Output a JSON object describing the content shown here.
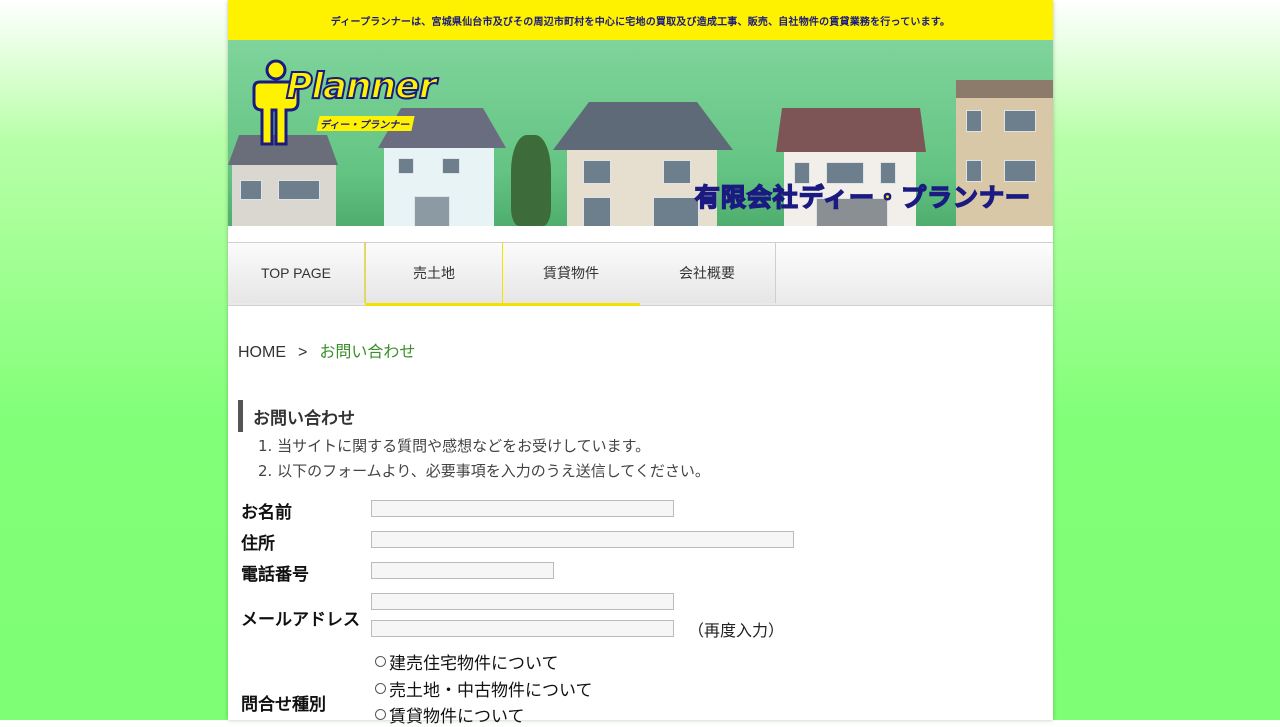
{
  "topbar": {
    "notice": "ディープランナーは、宮城県仙台市及びその周辺市町村を中心に宅地の買取及び造成工事、販売、自社物件の賃貸業務を行っています。"
  },
  "header": {
    "logo_text": "Planner",
    "logo_sub": "ディー・プランナー",
    "company_name": "有限会社ディー・プランナー"
  },
  "nav": {
    "items": [
      {
        "label": "TOP PAGE"
      },
      {
        "label": "売土地"
      },
      {
        "label": "賃貸物件"
      },
      {
        "label": "会社概要"
      }
    ]
  },
  "breadcrumb": {
    "home": "HOME",
    "separator": ">",
    "current": "お問い合わせ"
  },
  "section": {
    "title": "お問い合わせ",
    "notes": [
      "1. 当サイトに関する質問や感想などをお受けしています。",
      "2. 以下のフォームより、必要事項を入力のうえ送信してください。"
    ]
  },
  "form": {
    "name_label": "お名前",
    "address_label": "住所",
    "phone_label": "電話番号",
    "email_label": "メールアドレス",
    "email_confirm_note": "（再度入力）",
    "type_label": "問合せ種別",
    "type_options": [
      "建売住宅物件について",
      "売土地・中古物件について",
      "賃貸物件について"
    ],
    "name_value": "",
    "address_value": "",
    "phone_value": "",
    "email_value": "",
    "email_confirm_value": ""
  },
  "colors": {
    "topbar_bg": "#fff200",
    "accent_yellow": "#fff200",
    "navy": "#1a1a80",
    "breadcrumb_current": "#3a8f2a",
    "page_bg": "#7dfe74"
  }
}
